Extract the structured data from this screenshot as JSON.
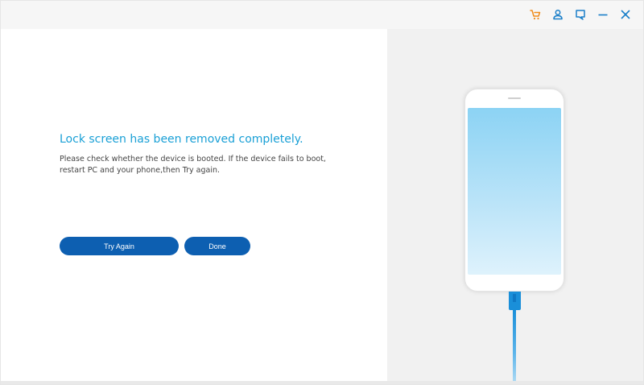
{
  "titlebar": {
    "icons": [
      "cart-icon",
      "user-icon",
      "feedback-icon",
      "minimize-icon",
      "close-icon"
    ],
    "cart_color": "#f08c1b",
    "icon_color": "#1a7fc9"
  },
  "main": {
    "heading": "Lock screen has been removed completely.",
    "description": "Please check whether the device is booted. If the device fails to boot, restart PC and your phone,then Try again.",
    "heading_color": "#1aa0d6"
  },
  "buttons": {
    "try_again_label": "Try Again",
    "done_label": "Done",
    "button_color": "#0d5fb1"
  },
  "illustration": {
    "device": "phone-with-usb-cable",
    "screen_color": "#8cd3f4",
    "cable_color": "#1a8fd9"
  }
}
